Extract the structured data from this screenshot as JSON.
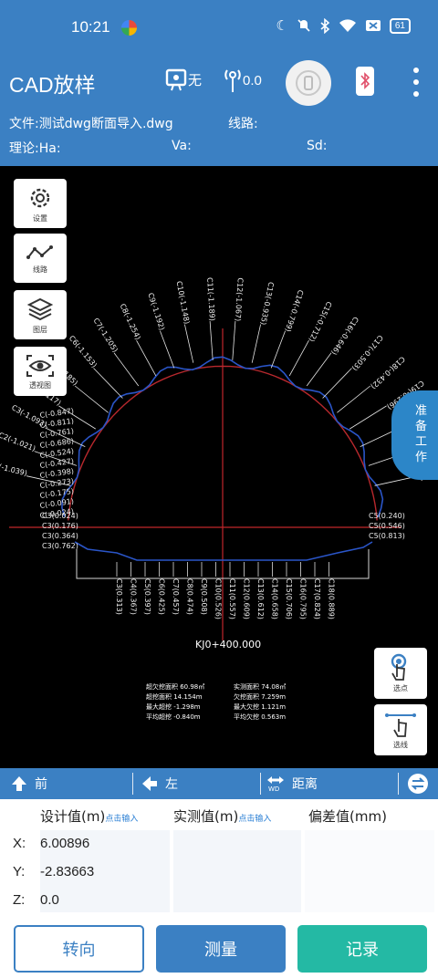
{
  "status_bar": {
    "time": "10:21",
    "battery": "61"
  },
  "app_bar": {
    "title": "CAD放样",
    "gps_label": "无",
    "antenna_value": "0.0"
  },
  "info": {
    "file_label": "文件:测试dwg断面导入.dwg",
    "line_label": "线路:",
    "theory_label": "理论:Ha:",
    "va_label": "Va:",
    "sd_label": "Sd:"
  },
  "tools": [
    {
      "label": "设置",
      "icon": "gear-icon"
    },
    {
      "label": "线路",
      "icon": "route-icon"
    },
    {
      "label": "图层",
      "icon": "layers-icon"
    },
    {
      "label": "透视图",
      "icon": "eye-icon"
    }
  ],
  "side_tab": {
    "label": "准备工作"
  },
  "select_buttons": {
    "point_label": "选点",
    "line_label": "选线"
  },
  "drawing": {
    "station": "KJ0+400.000",
    "stats": [
      {
        "left": "超欠挖面积 60.98㎡",
        "right": "实测面积 74.08㎡"
      },
      {
        "left": "超挖面积 14.154m",
        "right": "欠挖面积 7.259m"
      },
      {
        "left": "最大超挖 -1.298m",
        "right": "最大欠挖 1.121m"
      },
      {
        "left": "平均超挖 -0.840m",
        "right": "平均欠挖 0.563m"
      }
    ],
    "arch_labels": [
      "C1(-1.039)",
      "C2(-1.021)",
      "C3(-1.093)",
      "C4(-1.117)",
      "C5(-1.185)",
      "C6(-1.153)",
      "C7(-1.205)",
      "C8(-1.254)",
      "C9(-1.192)",
      "C10(-1.148)",
      "C11(-1.189)",
      "C12(-1.067)",
      "C13(-0.935)",
      "C14(-0.799)",
      "C15(-0.712)",
      "C16(-0.646)",
      "C17(-0.503)",
      "C18(-0.432)",
      "C19(-0.296)",
      "C20(-0.240)",
      "C21(-0.165)",
      "C22(-0.082)"
    ],
    "left_labels": [
      "C(-0.847)",
      "C(-0.811)",
      "C(-0.761)",
      "C(-0.686)",
      "C(-0.524)",
      "C(-0.427)",
      "C(-0.398)",
      "C(-0.273)",
      "C(-0.175)",
      "C(-0.091)",
      "C(-0.024)"
    ],
    "bottom_labels": [
      "C3(0.313)",
      "C4(0.367)",
      "C5(0.397)",
      "C6(0.425)",
      "C7(0.457)",
      "C8(0.474)",
      "C9(0.508)",
      "C10(0.526)",
      "C11(0.557)",
      "C12(0.609)",
      "C13(0.612)",
      "C14(0.658)",
      "C15(0.706)",
      "C16(0.795)",
      "C17(0.824)",
      "C18(0.889)"
    ],
    "left_side_labels": [
      "C3(0.024)",
      "C3(0.176)",
      "C3(0.364)",
      "C3(0.762)"
    ],
    "right_side_labels": [
      "C5(0.240)",
      "C5(0.546)",
      "C5(0.813)"
    ]
  },
  "direction_bar": {
    "forward": "前",
    "left": "左",
    "distance": "距离"
  },
  "values": {
    "design_header": "设计值(m)",
    "design_hint": "点击输入",
    "actual_header": "实测值(m)",
    "actual_hint": "点击输入",
    "deviation_header": "偏差值(mm)",
    "rows": [
      {
        "axis": "X:",
        "design": "6.00896"
      },
      {
        "axis": "Y:",
        "design": "-2.83663"
      },
      {
        "axis": "Z:",
        "design": "0.0"
      }
    ]
  },
  "buttons": {
    "turn": "转向",
    "measure": "测量",
    "record": "记录"
  }
}
